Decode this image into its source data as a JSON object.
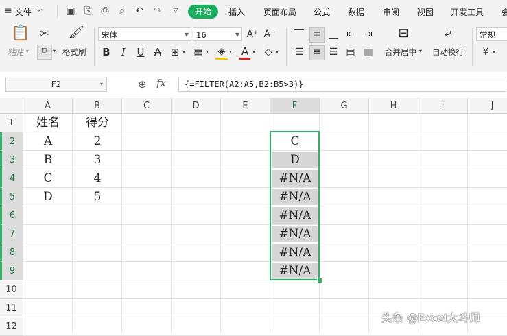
{
  "menubar": {
    "file": "文件",
    "tabs": [
      "开始",
      "插入",
      "页面布局",
      "公式",
      "数据",
      "审阅",
      "视图",
      "开发工具",
      "会"
    ]
  },
  "ribbon": {
    "paste": "粘贴",
    "format_painter": "格式刷",
    "font_name": "宋体",
    "font_size": "16",
    "merge_center": "合并居中",
    "wrap_text": "自动换行",
    "number_format": "常规",
    "currency": "¥"
  },
  "formula_bar": {
    "name_box": "F2",
    "fx": "fx",
    "formula": "{=FILTER(A2:A5,B2:B5>3)}"
  },
  "columns": [
    "A",
    "B",
    "C",
    "D",
    "E",
    "F",
    "G",
    "H",
    "I",
    "J"
  ],
  "rows": [
    "1",
    "2",
    "3",
    "4",
    "5",
    "6",
    "7",
    "8",
    "9",
    "10",
    "11",
    "12"
  ],
  "cells": {
    "A1": "姓名",
    "B1": "得分",
    "A2": "A",
    "B2": "2",
    "A3": "B",
    "B3": "3",
    "A4": "C",
    "B4": "4",
    "A5": "D",
    "B5": "5",
    "F2": "C",
    "F3": "D",
    "F4": "#N/A",
    "F5": "#N/A",
    "F6": "#N/A",
    "F7": "#N/A",
    "F8": "#N/A",
    "F9": "#N/A"
  },
  "selection": "F2:F9",
  "accent_color": "#19ad5d",
  "watermark": "头条 @Excel大斗师"
}
